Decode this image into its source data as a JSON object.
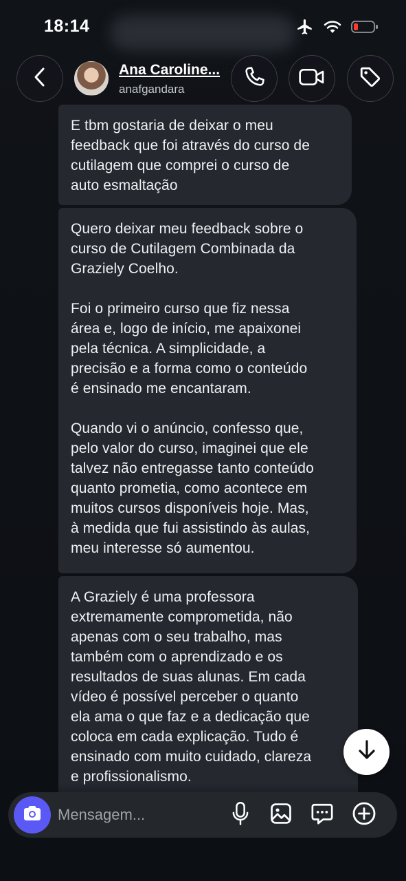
{
  "status_bar": {
    "time": "18:14"
  },
  "header": {
    "contact_name": "Ana Caroline...",
    "contact_handle": "anafgandara"
  },
  "messages": [
    {
      "paragraphs": [
        "E tbm gostaria de deixar o meu\nfeedback que foi através do curso de\ncutilagem que comprei o curso de\nauto esmaltação"
      ]
    },
    {
      "paragraphs": [
        "Quero deixar meu feedback sobre o\ncurso de Cutilagem Combinada da\nGraziely Coelho.",
        "Foi o primeiro curso que fiz nessa\nárea e, logo de início, me apaixonei\npela técnica. A simplicidade, a\nprecisão e a forma como o conteúdo\né ensinado me encantaram.",
        "Quando vi o anúncio, confesso que,\npelo valor do curso, imaginei que ele\ntalvez não entregasse tanto conteúdo\nquanto prometia, como acontece em\nmuitos cursos disponíveis hoje. Mas,\nà medida que fui assistindo às aulas,\nmeu interesse só aumentou."
      ]
    },
    {
      "paragraphs": [
        "A Graziely é uma professora\nextremamente comprometida, não\napenas com o seu trabalho, mas\ntambém com o aprendizado e os\nresultados de suas alunas. Em cada\nvídeo é possível perceber o quanto\nela ama o que faz e a dedicação que\ncoloca em cada explicação. Tudo é\nensinado com muito cuidado, clareza\ne profissionalismo."
      ]
    }
  ],
  "composer": {
    "placeholder": "Mensagem..."
  },
  "icons": {
    "back": "chevron-left-icon",
    "call": "phone-icon",
    "video": "video-camera-icon",
    "tag": "tag-icon",
    "scroll_down": "arrow-down-icon",
    "camera": "camera-icon",
    "mic": "microphone-icon",
    "gallery": "image-icon",
    "sticker": "chat-bubble-icon",
    "plus": "plus-circle-icon"
  },
  "colors": {
    "bubble": "#25282e",
    "accent": "#5a59f5",
    "background": "#0c0f14",
    "battery_low": "#ff3b30"
  }
}
